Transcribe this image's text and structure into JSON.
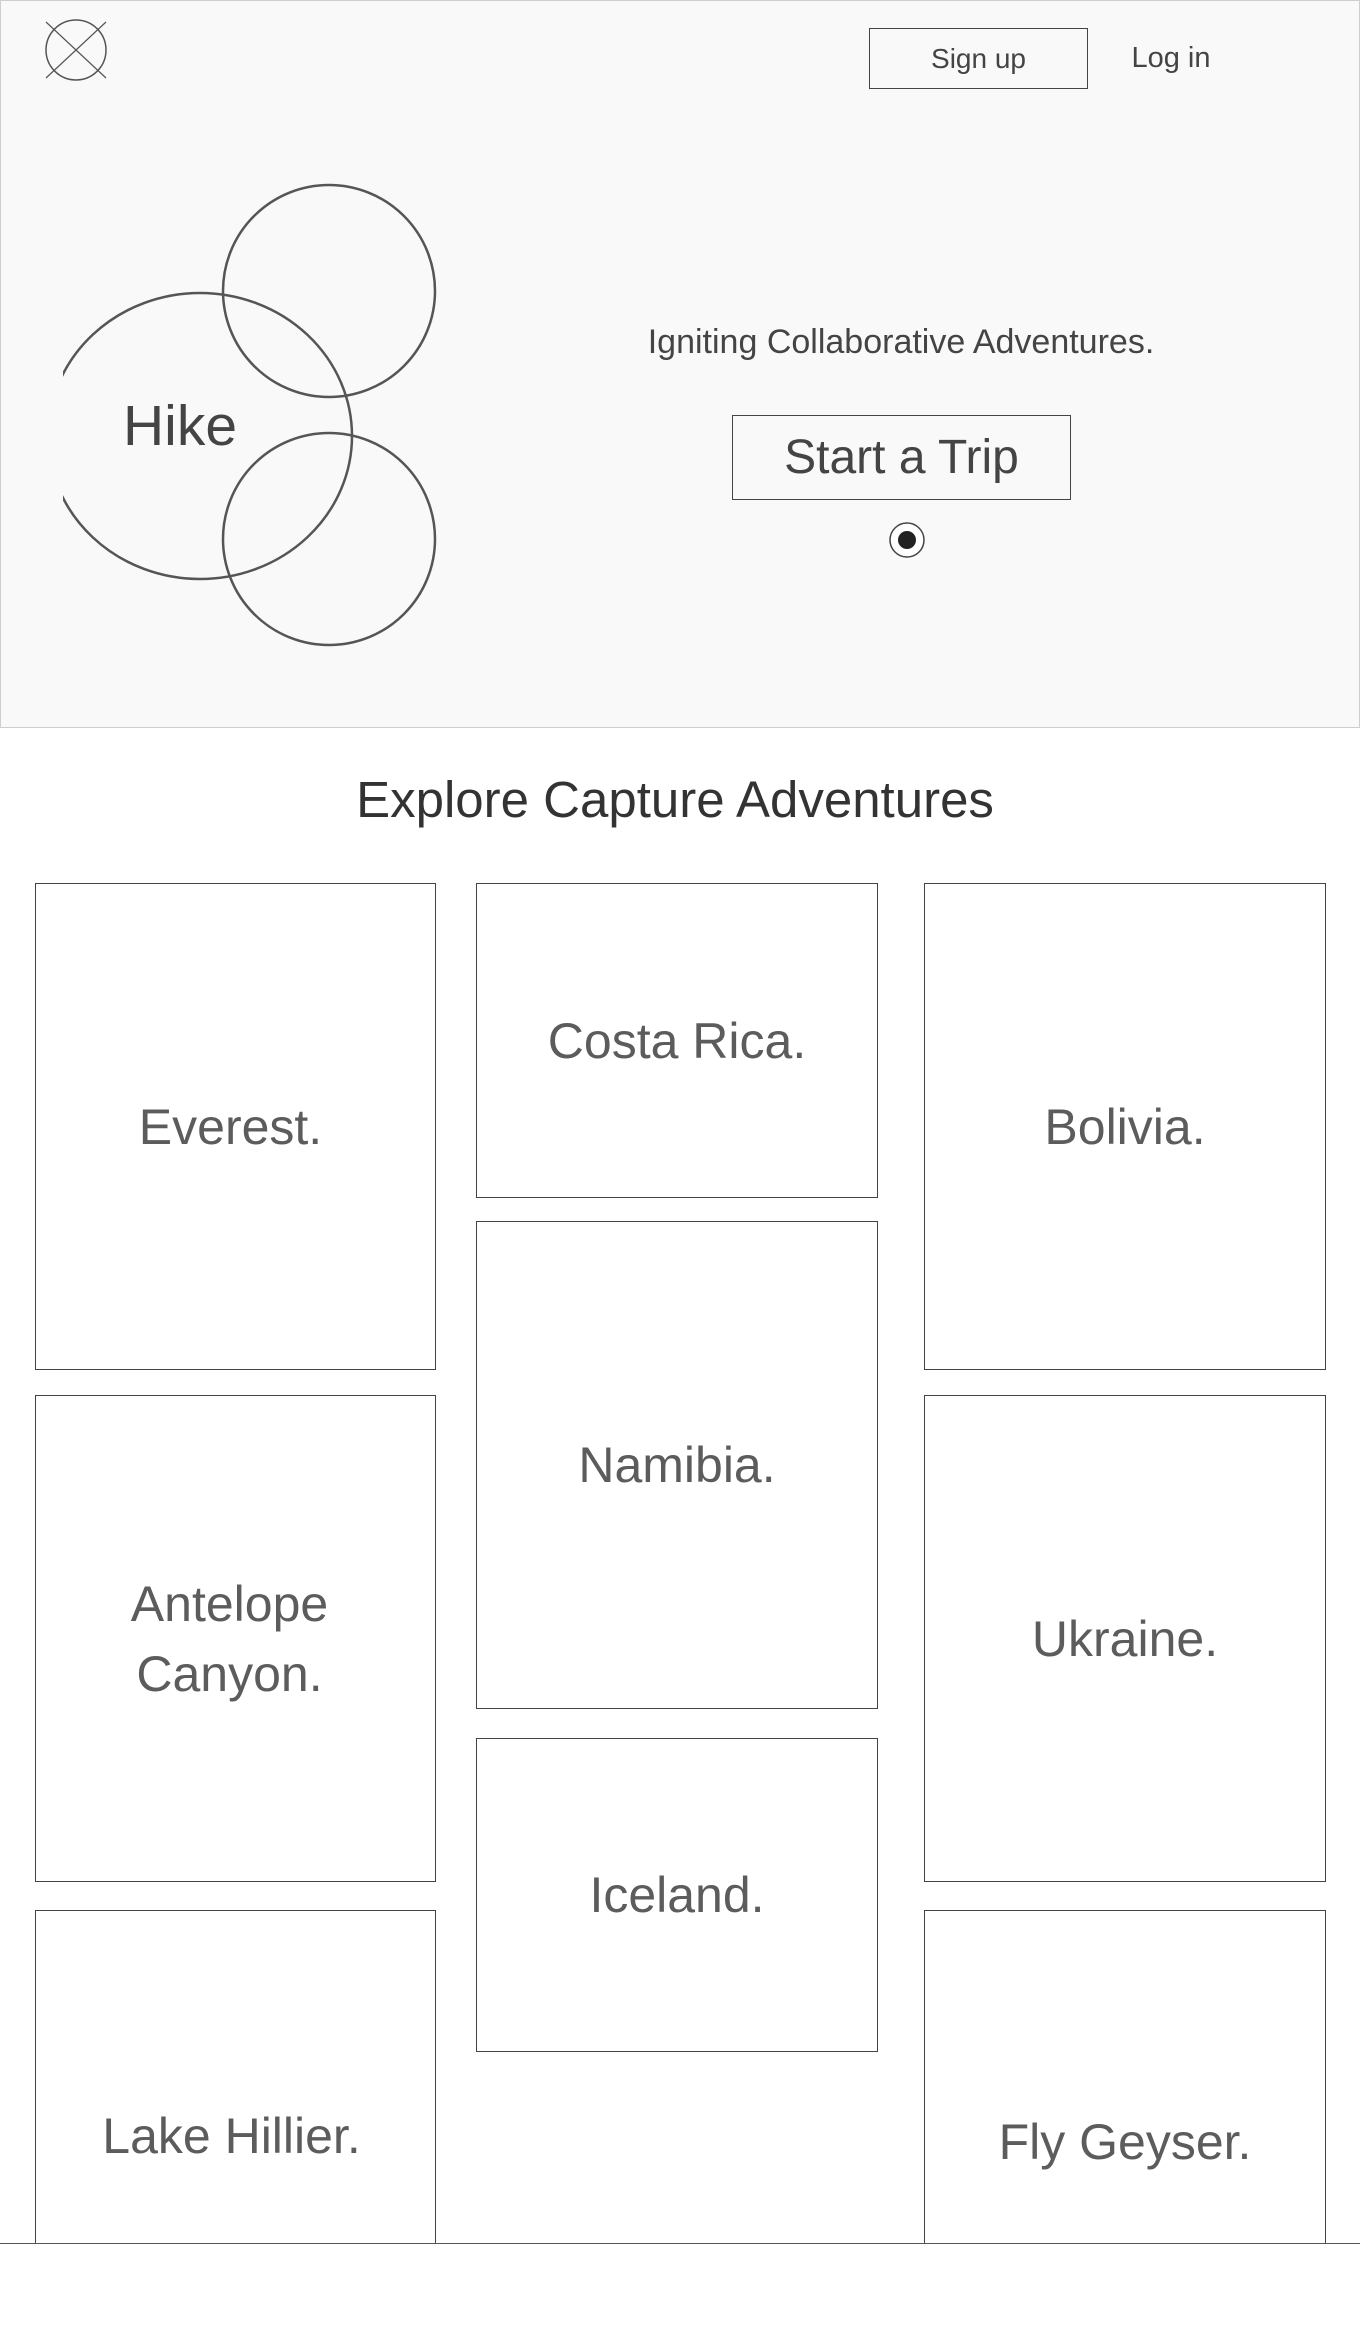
{
  "header": {
    "logo_icon": "placeholder-logo-icon",
    "signup_label": "Sign up",
    "login_label": "Log in"
  },
  "hero": {
    "brand_text": "Hike",
    "tagline": "Igniting Collaborative Adventures.",
    "cta_label": "Start a Trip",
    "indicator_icon": "radio-selected-icon"
  },
  "explore": {
    "title": "Explore Capture Adventures",
    "cards": [
      {
        "label": "Everest."
      },
      {
        "label": "Costa Rica."
      },
      {
        "label": "Bolivia."
      },
      {
        "label": "Namibia."
      },
      {
        "label": "Antelope\nCanyon."
      },
      {
        "label": "Ukraine."
      },
      {
        "label": "Iceland."
      },
      {
        "label": "Lake Hillier."
      },
      {
        "label": "Fly Geyser."
      }
    ]
  },
  "colors": {
    "line": "#444444",
    "hero_background": "#f9f9f9",
    "page_background": "#ffffff",
    "card_text": "#5c5c5c"
  }
}
